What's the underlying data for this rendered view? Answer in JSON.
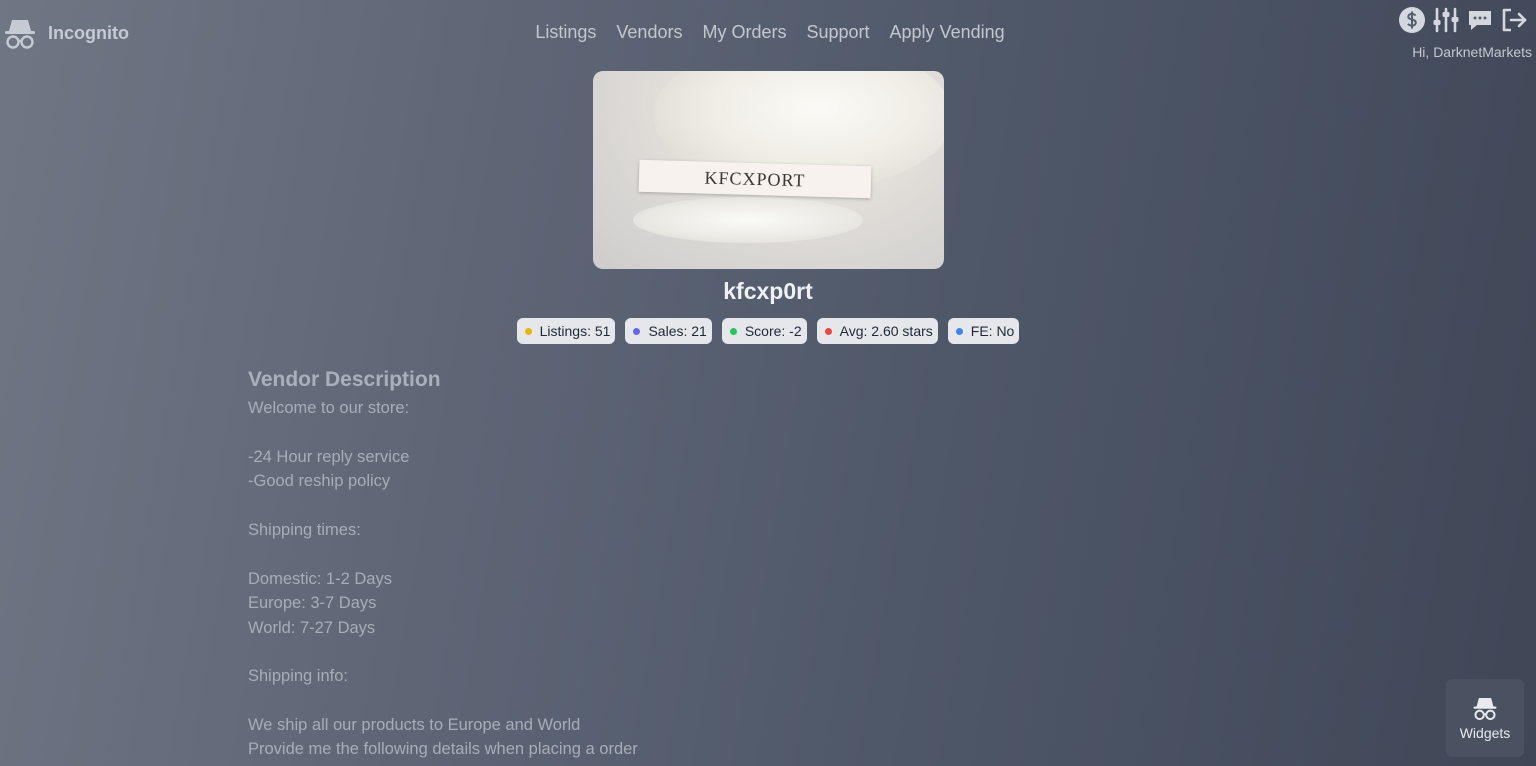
{
  "brand": {
    "name": "Incognito",
    "icon": "incognito-icon"
  },
  "nav": [
    {
      "label": "Listings"
    },
    {
      "label": "Vendors"
    },
    {
      "label": "My Orders"
    },
    {
      "label": "Support"
    },
    {
      "label": "Apply Vending"
    }
  ],
  "top_icons": [
    "dollar-icon",
    "sliders-icon",
    "chat-icon",
    "logout-icon"
  ],
  "greeting": "Hi, DarknetMarkets",
  "vendor": {
    "image_label": "KFCXPORT",
    "name": "kfcxp0rt",
    "badges": [
      {
        "text": "Listings: 51",
        "color": "#eab308"
      },
      {
        "text": "Sales: 21",
        "color": "#6366f1"
      },
      {
        "text": "Score: -2",
        "color": "#22c55e"
      },
      {
        "text": "Avg: 2.60 stars",
        "color": "#ef4444"
      },
      {
        "text": "FE: No",
        "color": "#3b82f6"
      }
    ]
  },
  "description": {
    "heading": "Vendor Description",
    "lines": [
      "Welcome to our store:",
      "",
      "-24 Hour reply service",
      "-Good reship policy",
      "",
      "Shipping times:",
      "",
      "Domestic: 1-2 Days",
      "Europe: 3-7 Days",
      "World: 7-27 Days",
      "",
      "Shipping info:",
      "",
      "We ship all our products to Europe and World",
      "Provide me the following details when placing a order"
    ]
  },
  "widgets": {
    "label": "Widgets",
    "icon": "incognito-icon"
  }
}
